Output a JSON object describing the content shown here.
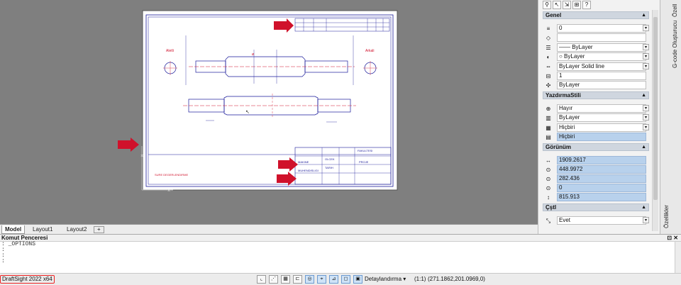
{
  "canvas": {
    "bg_color": "#7f7f7f",
    "paper_color": "#ffffff",
    "line_color": "#1a1a9a",
    "red_color": "#d0112b",
    "title_block_text": [
      "MAKINE",
      "MUHENDISLIGI",
      "FAKULTESI",
      "OLCEK",
      "TARIH",
      "PROJE"
    ],
    "left_label": "Aletli",
    "right_label": "Arkali",
    "bottom_label": "SURE DEGERLENDIRME",
    "detail_label": "A-A",
    "header_cols": [
      "SIRA",
      "ADET",
      "MALZEME",
      "AÇIKLAMA"
    ]
  },
  "layout_tabs": {
    "model": "Model",
    "layout1": "Layout1",
    "layout2": "Layout2",
    "add": "+"
  },
  "properties": {
    "sections": {
      "genel": "Genel",
      "yazdirma": "YazdırmaStili",
      "gorunum": "Görünüm",
      "cstl": "Çştl"
    },
    "genel_rows": [
      "0",
      "",
      "—— ByLayer",
      "○ ByLayer",
      "ByLayer     Solid line",
      "1",
      "ByLayer"
    ],
    "yazdirma_rows": [
      "Hayır",
      "ByLayer",
      "Hiçbiri",
      "Hiçbiri"
    ],
    "gorunum_rows": [
      "1909.2617",
      "448.9972",
      "282.436",
      "0",
      "815.913"
    ],
    "cstl_rows": [
      "Evet"
    ]
  },
  "side_tabs": {
    "ozell": "Özell",
    "gcode": "G-code Oluşturucu",
    "ozellikler": "Özellikler"
  },
  "command": {
    "title": "Komut Penceresi",
    "lines": [
      ": _OPTIONS",
      ":",
      ":",
      ":"
    ]
  },
  "status": {
    "app_name": "DraftSight 2022 x64",
    "detail": "Detaylandırma",
    "scale": "(1:1)",
    "coords": "(271.1862,201.0969,0)"
  }
}
